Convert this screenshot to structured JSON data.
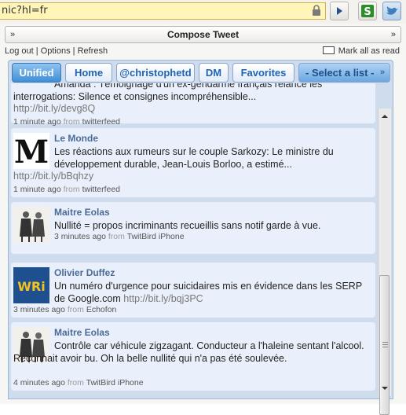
{
  "url_bar": {
    "text": "nic?hl=fr"
  },
  "compose": {
    "label": "Compose Tweet"
  },
  "links": {
    "logout": "Log out",
    "options": "Options",
    "refresh": "Refresh",
    "separator": "|"
  },
  "mark_all": {
    "label": "Mark all as read"
  },
  "tabs": [
    {
      "label": "Unified",
      "active": true
    },
    {
      "label": "Home"
    },
    {
      "label": "@christophetd"
    },
    {
      "label": "DM"
    },
    {
      "label": "Favorites"
    },
    {
      "label": "- Select a list -"
    }
  ],
  "tweets": [
    {
      "author": "",
      "text": "Amanda : Témoignage d'un ex-gendarme français relance les interrogations: Silence et consignes incompréhensible...",
      "url": "http://bit.ly/devg8Q",
      "time": "1 minute ago",
      "from_label": "from",
      "source": "twitterfeed",
      "avatar_icon": "le-monde-logo"
    },
    {
      "author": "Le Monde",
      "text": "Les réactions aux rumeurs sur le couple Sarkozy: Le ministre du développement durable, Jean-Louis Borloo, a estimé...",
      "url": "http://bit.ly/bBqhzy",
      "time": "1 minute ago",
      "from_label": "from",
      "source": "twitterfeed",
      "avatar_icon": "le-monde-logo"
    },
    {
      "author": "Maitre Eolas",
      "text": "Nullité = propos incriminants recueillis sans notif garde à vue.",
      "url": "",
      "time": "3 minutes ago",
      "from_label": "from",
      "source": "TwitBird iPhone",
      "avatar_icon": "lawyers-illustration"
    },
    {
      "author": "Olivier Duffez",
      "text": "Un numéro d'urgence pour suicidaires mis en évidence dans les SERP de Google.com",
      "url": "http://bit.ly/bqj3PC",
      "time": "3 minutes ago",
      "from_label": "from",
      "source": "Echofon",
      "avatar_icon": "wri-logo",
      "avatar_text": "WRi"
    },
    {
      "author": "Maitre Eolas",
      "text": "Contrôle car véhicule zigzagant. Conducteur a l'haleine sentant l'alcool. Reconnait avoir bu. Oh la belle nullité qui n'a pas été soulevée.",
      "url": "",
      "time": "4 minutes ago",
      "from_label": "from",
      "source": "TwitBird iPhone",
      "avatar_icon": "lawyers-illustration"
    }
  ],
  "colors": {
    "tab_accent": "#3f8fd6",
    "author": "#4b6b96",
    "timeline_bg": "#cfdcee",
    "tweet_bg": "#eaf0fb"
  }
}
